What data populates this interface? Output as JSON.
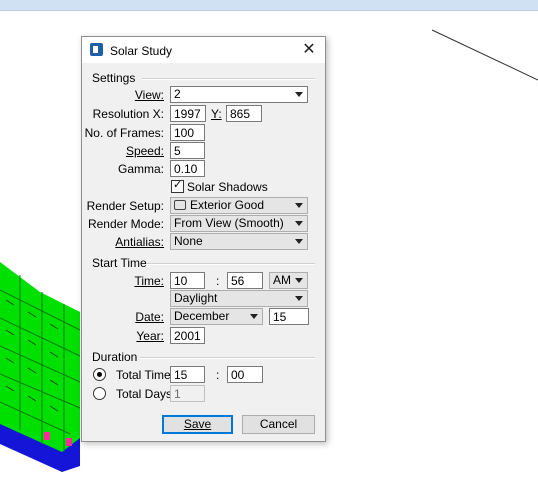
{
  "dialog": {
    "title": "Solar Study",
    "close_glyph": "✕"
  },
  "settings": {
    "section_label": "Settings",
    "view_label": "View:",
    "view_value": "2",
    "resolution_label": "Resolution X:",
    "resolution_x": "1997",
    "resolution_y_label": "Y:",
    "resolution_y": "865",
    "frames_label": "No. of Frames:",
    "frames_value": "100",
    "speed_label": "Speed:",
    "speed_value": "5",
    "gamma_label": "Gamma:",
    "gamma_value": "0.10",
    "solar_shadows_label": "Solar Shadows",
    "solar_shadows_checked": true,
    "render_setup_label": "Render Setup:",
    "render_setup_value": "Exterior Good",
    "render_mode_label": "Render Mode:",
    "render_mode_value": "From View (Smooth)",
    "antialias_label": "Antialias:",
    "antialias_value": "None"
  },
  "start_time": {
    "section_label": "Start Time",
    "time_label": "Time:",
    "hour": "10",
    "separator": ":",
    "minute": "56",
    "ampm": "AM",
    "time_mode": "Daylight",
    "date_label": "Date:",
    "month": "December",
    "day": "15",
    "year_label": "Year:",
    "year": "2001"
  },
  "duration": {
    "section_label": "Duration",
    "total_time_label": "Total Time:",
    "total_time_hours": "15",
    "separator": ":",
    "total_time_minutes": "00",
    "total_days_label": "Total Days:",
    "total_days_value": "1",
    "selected": "total_time"
  },
  "buttons": {
    "save_label": "Save",
    "cancel_label": "Cancel"
  },
  "colors": {
    "model_green": "#00e000",
    "model_blue": "#1515d8",
    "accent": "#0078d7"
  }
}
